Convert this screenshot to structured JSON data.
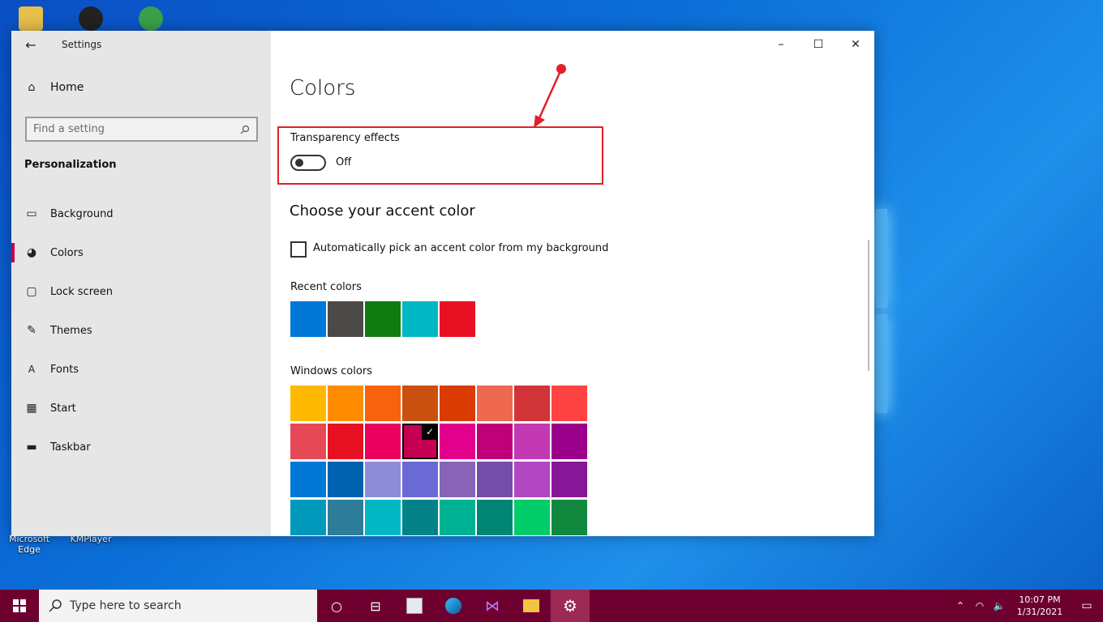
{
  "desktop": {
    "icons": [
      {
        "label": "Microsoft Edge"
      },
      {
        "label": "KMPlayer"
      }
    ]
  },
  "window": {
    "title": "Settings",
    "back_icon": "arrow-left-icon",
    "controls": {
      "minimize": "–",
      "maximize": "☐",
      "close": "✕"
    }
  },
  "sidebar": {
    "home_label": "Home",
    "search_placeholder": "Find a setting",
    "section_title": "Personalization",
    "items": [
      {
        "label": "Background",
        "icon": "image-icon"
      },
      {
        "label": "Colors",
        "icon": "palette-icon",
        "active": true
      },
      {
        "label": "Lock screen",
        "icon": "lock-screen-icon"
      },
      {
        "label": "Themes",
        "icon": "themes-icon"
      },
      {
        "label": "Fonts",
        "icon": "fonts-icon"
      },
      {
        "label": "Start",
        "icon": "start-icon"
      },
      {
        "label": "Taskbar",
        "icon": "taskbar-icon"
      }
    ]
  },
  "main": {
    "title": "Colors",
    "transparency_label": "Transparency effects",
    "transparency_state": "Off",
    "accent_title": "Choose your accent color",
    "auto_pick_label": "Automatically pick an accent color from my background",
    "recent_label": "Recent colors",
    "recent_colors": [
      "#0078d7",
      "#4c4a48",
      "#107c10",
      "#00b7c3",
      "#e81123"
    ],
    "windows_label": "Windows colors",
    "windows_colors": [
      "#ffb900",
      "#ff8c00",
      "#f7630c",
      "#ca5010",
      "#da3b01",
      "#ef6950",
      "#d13438",
      "#ff4343",
      "#e74856",
      "#e81123",
      "#ea005e",
      "#c30052",
      "#e3008c",
      "#bf0077",
      "#c239b3",
      "#9a0089",
      "#0078d7",
      "#0063b1",
      "#8e8cd8",
      "#6b69d6",
      "#8764b8",
      "#744da9",
      "#b146c2",
      "#881798",
      "#0099bc",
      "#2d7d9a",
      "#00b7c3",
      "#038387",
      "#00b294",
      "#018574",
      "#00cc6a",
      "#10893e"
    ],
    "selected_color_index": 11
  },
  "taskbar": {
    "search_placeholder": "Type here to search",
    "time": "10:07 PM",
    "date": "1/31/2021"
  },
  "colors": {
    "accent": "#c30052",
    "taskbar": "#6e0030",
    "highlight": "#e0202a"
  }
}
